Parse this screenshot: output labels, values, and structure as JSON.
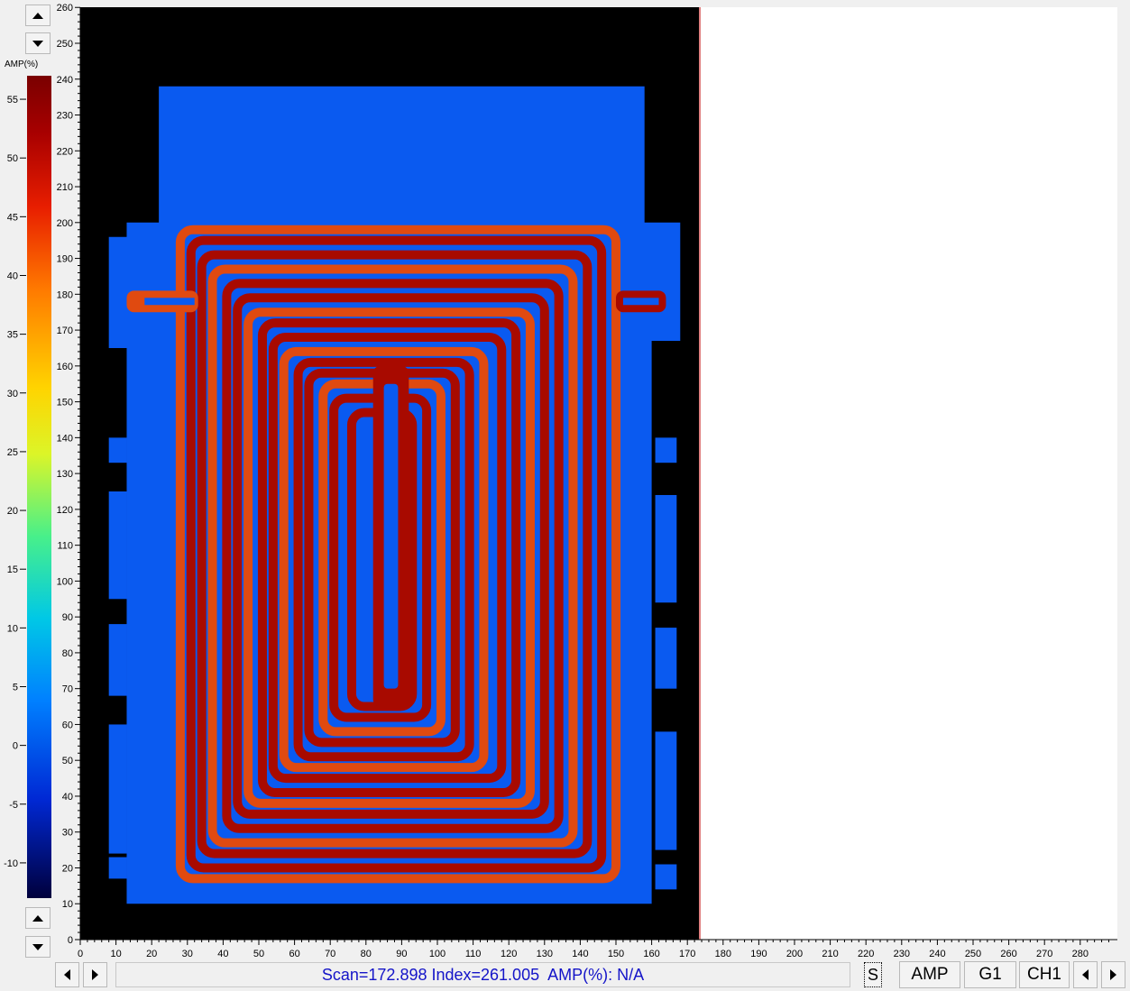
{
  "colorbar": {
    "label": "AMP(%)",
    "left_ticks": [
      "55",
      "50",
      "45",
      "40",
      "35",
      "30",
      "25",
      "20",
      "15",
      "10",
      "5",
      "0",
      "-5",
      "-10"
    ],
    "left_values": [
      55,
      50,
      45,
      40,
      35,
      30,
      25,
      20,
      15,
      10,
      5,
      0,
      -5,
      -10
    ],
    "colors": [
      "#00003c",
      "#0028d4",
      "#0080ff",
      "#00c8e6",
      "#48f08a",
      "#dcf528",
      "#ffd400",
      "#ff7a00",
      "#e81e00",
      "#a80000",
      "#7a0000"
    ]
  },
  "y_axis": {
    "ticks": [
      "260",
      "250",
      "240",
      "230",
      "220",
      "210",
      "200",
      "190",
      "180",
      "170",
      "160",
      "150",
      "140",
      "130",
      "120",
      "110",
      "100",
      "90",
      "80",
      "70",
      "60",
      "50",
      "40",
      "30",
      "20",
      "10",
      "0"
    ],
    "values": [
      260,
      250,
      240,
      230,
      220,
      210,
      200,
      190,
      180,
      170,
      160,
      150,
      140,
      130,
      120,
      110,
      100,
      90,
      80,
      70,
      60,
      50,
      40,
      30,
      20,
      10,
      0
    ],
    "max": 260
  },
  "x_axis": {
    "ticks": [
      "0",
      "10",
      "20",
      "30",
      "40",
      "50",
      "60",
      "70",
      "80",
      "90",
      "100",
      "110",
      "120",
      "130",
      "140",
      "150",
      "160",
      "170",
      "180",
      "190",
      "200",
      "210",
      "220",
      "230",
      "240",
      "250",
      "260",
      "270",
      "280"
    ],
    "values": [
      0,
      10,
      20,
      30,
      40,
      50,
      60,
      70,
      80,
      90,
      100,
      110,
      120,
      130,
      140,
      150,
      160,
      170,
      180,
      190,
      200,
      210,
      220,
      230,
      240,
      250,
      260,
      270,
      280
    ],
    "max": 290
  },
  "status": {
    "text": "Scan=172.898 Index=261.005  AMP(%): N/A",
    "color": "#1414c8"
  },
  "toolbar": {
    "s_label": "S",
    "amp_label": "AMP",
    "g1_label": "G1",
    "ch1_label": "CH1"
  },
  "image": {
    "background": "#000000",
    "plate_color": "#0a5af0",
    "channel_color": "#a80a00",
    "channel_hot_color": "#e04a10",
    "cursor_color": "#c00000",
    "scan_edge_x": 172.9
  }
}
